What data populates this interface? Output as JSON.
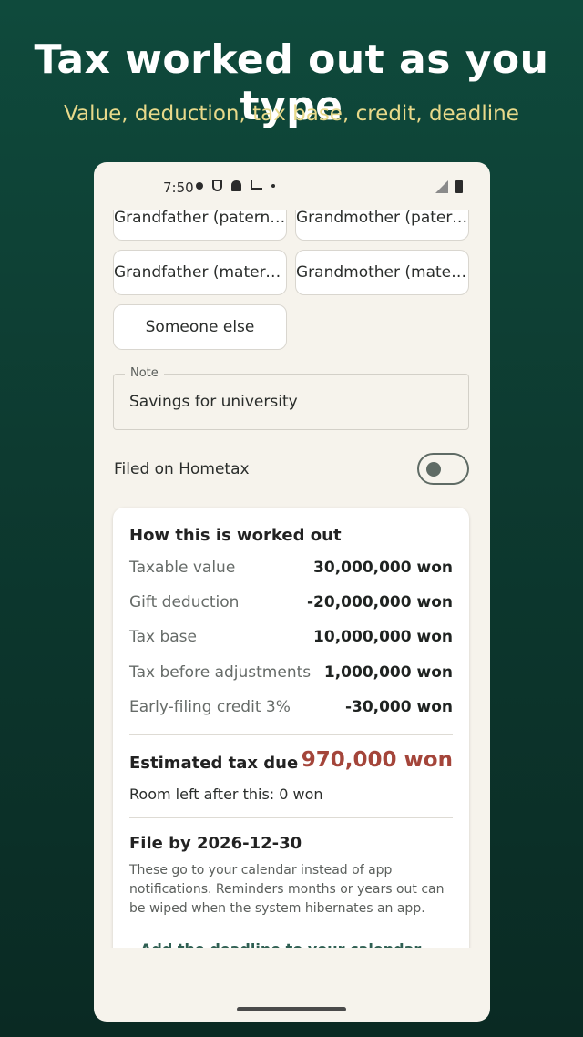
{
  "promo": {
    "title": "Tax worked out as you type",
    "subtitle": "Value, deduction, tax base, credit, deadline"
  },
  "status_bar": {
    "time": "7:50"
  },
  "relationship_chips": [
    {
      "label": "Grandfather (paternal)"
    },
    {
      "label": "Grandmother (patern…"
    },
    {
      "label": "Grandfather (matern…"
    },
    {
      "label": "Grandmother (mater…"
    },
    {
      "label": "Someone else"
    }
  ],
  "note": {
    "label": "Note",
    "value": "Savings for university"
  },
  "filed": {
    "label": "Filed on Hometax",
    "on": false
  },
  "breakdown": {
    "title": "How this is worked out",
    "rows": [
      {
        "label": "Taxable value",
        "value": "30,000,000 won"
      },
      {
        "label": "Gift deduction",
        "value": "-20,000,000 won"
      },
      {
        "label": "Tax base",
        "value": "10,000,000 won"
      },
      {
        "label": "Tax before adjustments",
        "value": "1,000,000 won"
      },
      {
        "label": "Early-filing credit 3%",
        "value": "-30,000 won"
      }
    ],
    "due_label": "Estimated tax due",
    "due_value": "970,000 won",
    "room_left": "Room left after this: 0 won",
    "file_by": "File by 2026-12-30",
    "file_desc": "These go to your calendar instead of app notifications. Reminders months or years out can be wiped when the system hibernates an app.",
    "add_deadline": "Add the deadline to your calendar"
  },
  "colors": {
    "background": "#0f4a3c",
    "subtitle": "#e8d98a",
    "due_value": "#a4453a",
    "card": "#ffffff",
    "phone_bg": "#f6f3ec"
  }
}
